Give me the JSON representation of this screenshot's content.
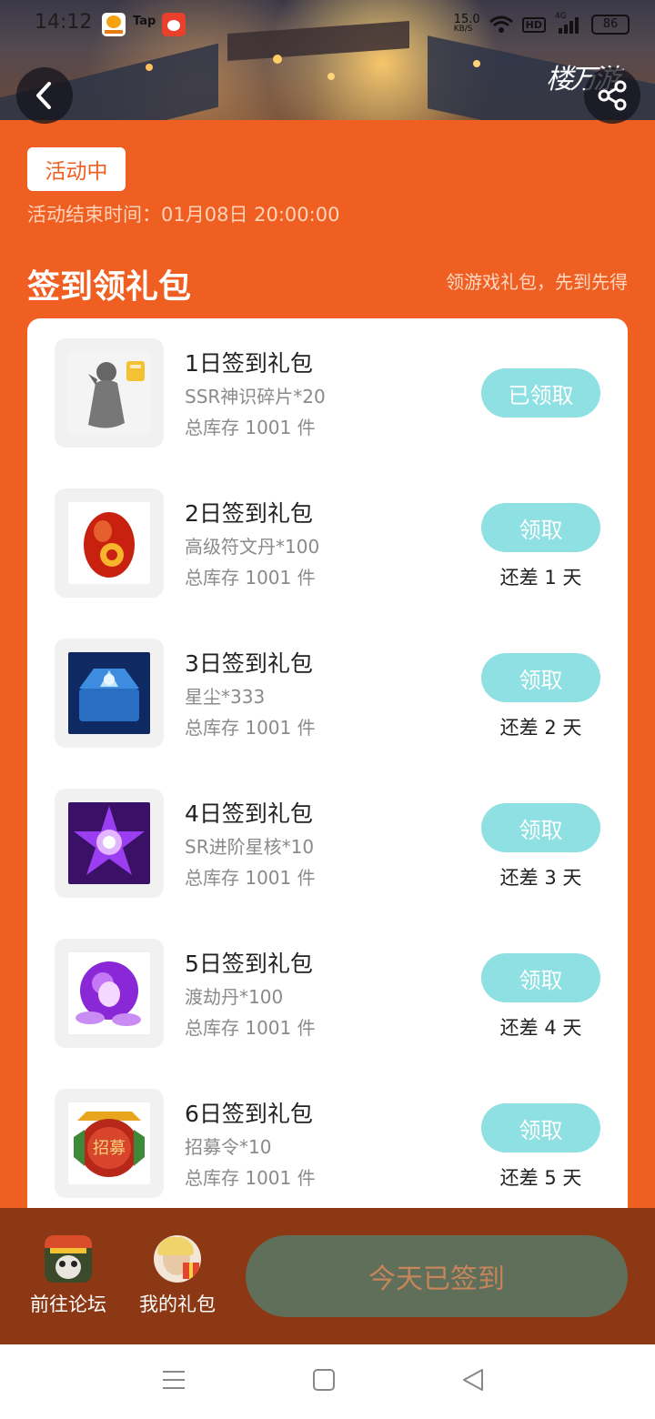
{
  "status_bar": {
    "time": "14:12",
    "net_speed": "15.0",
    "net_unit": "KB/S",
    "hd": "HD",
    "network": "4G",
    "battery": "86",
    "apps": [
      "bilibili-game-icon",
      "tap-icon",
      "game-app-icon"
    ],
    "tap_label": "Tap"
  },
  "header": {
    "back_icon": "chevron-left-icon",
    "share_icon": "share-icon",
    "brand": "楼万游"
  },
  "activity": {
    "status_badge": "活动中",
    "end_time": "活动结束时间：01月08日 20:00:00"
  },
  "section": {
    "title": "签到领礼包",
    "subtitle": "领游戏礼包，先到先得"
  },
  "gifts": [
    {
      "title": "1日签到礼包",
      "item": "SSR神识碎片*20",
      "stock": "总库存 1001 件",
      "button": "已领取",
      "remaining": ""
    },
    {
      "title": "2日签到礼包",
      "item": "高级符文丹*100",
      "stock": "总库存 1001 件",
      "button": "领取",
      "remaining": "还差 1 天"
    },
    {
      "title": "3日签到礼包",
      "item": "星尘*333",
      "stock": "总库存 1001 件",
      "button": "领取",
      "remaining": "还差 2 天"
    },
    {
      "title": "4日签到礼包",
      "item": "SR进阶星核*10",
      "stock": "总库存 1001 件",
      "button": "领取",
      "remaining": "还差 3 天"
    },
    {
      "title": "5日签到礼包",
      "item": "渡劫丹*100",
      "stock": "总库存 1001 件",
      "button": "领取",
      "remaining": "还差 4 天"
    },
    {
      "title": "6日签到礼包",
      "item": "招募令*10",
      "stock": "总库存 1001 件",
      "button": "领取",
      "remaining": "还差 5 天"
    }
  ],
  "bottom": {
    "forum_label": "前往论坛",
    "my_gifts_label": "我的礼包",
    "signed_label": "今天已签到",
    "seal_text": "招募"
  },
  "colors": {
    "accent": "#f05f22",
    "claim_button": "#8fe0e3",
    "bottom_bar": "#8c3814",
    "signed_button": "#5f6f59"
  },
  "nav": {
    "menu_icon": "menu-icon",
    "home_icon": "square-icon",
    "back_icon": "triangle-back-icon"
  }
}
